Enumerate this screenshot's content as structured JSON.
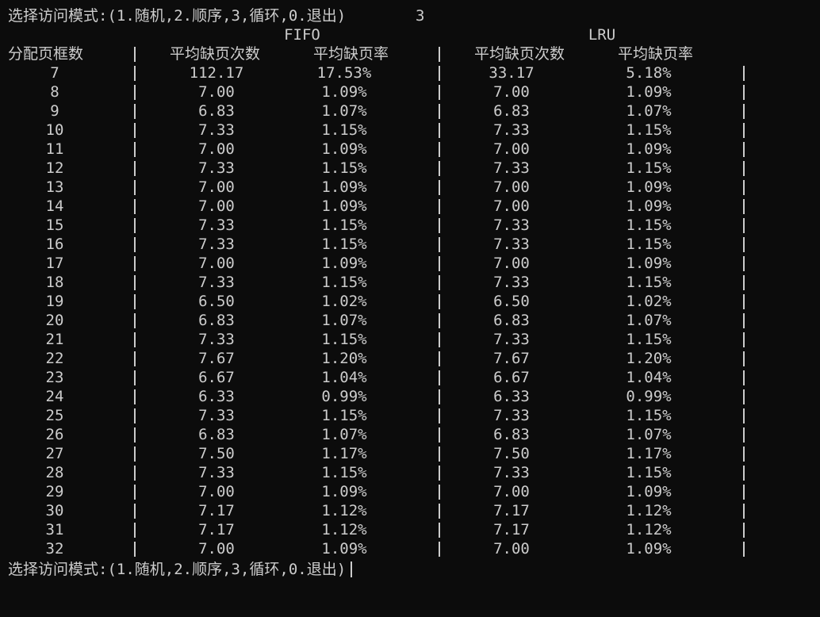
{
  "prompt_text": "选择访问模式:(1.随机,2.顺序,3,循环,0.退出)",
  "first_input": "3",
  "fifo_label": "FIFO",
  "lru_label": "LRU",
  "headers": {
    "frames": "分配页框数",
    "fifo_faults": "平均缺页次数",
    "fifo_rate": "平均缺页率",
    "lru_faults": "平均缺页次数",
    "lru_rate": "平均缺页率"
  },
  "separator_char": "|",
  "rows": [
    {
      "frames": "7",
      "fifo_faults": "112.17",
      "fifo_rate": "17.53%",
      "lru_faults": "33.17",
      "lru_rate": "5.18%"
    },
    {
      "frames": "8",
      "fifo_faults": "7.00",
      "fifo_rate": "1.09%",
      "lru_faults": "7.00",
      "lru_rate": "1.09%"
    },
    {
      "frames": "9",
      "fifo_faults": "6.83",
      "fifo_rate": "1.07%",
      "lru_faults": "6.83",
      "lru_rate": "1.07%"
    },
    {
      "frames": "10",
      "fifo_faults": "7.33",
      "fifo_rate": "1.15%",
      "lru_faults": "7.33",
      "lru_rate": "1.15%"
    },
    {
      "frames": "11",
      "fifo_faults": "7.00",
      "fifo_rate": "1.09%",
      "lru_faults": "7.00",
      "lru_rate": "1.09%"
    },
    {
      "frames": "12",
      "fifo_faults": "7.33",
      "fifo_rate": "1.15%",
      "lru_faults": "7.33",
      "lru_rate": "1.15%"
    },
    {
      "frames": "13",
      "fifo_faults": "7.00",
      "fifo_rate": "1.09%",
      "lru_faults": "7.00",
      "lru_rate": "1.09%"
    },
    {
      "frames": "14",
      "fifo_faults": "7.00",
      "fifo_rate": "1.09%",
      "lru_faults": "7.00",
      "lru_rate": "1.09%"
    },
    {
      "frames": "15",
      "fifo_faults": "7.33",
      "fifo_rate": "1.15%",
      "lru_faults": "7.33",
      "lru_rate": "1.15%"
    },
    {
      "frames": "16",
      "fifo_faults": "7.33",
      "fifo_rate": "1.15%",
      "lru_faults": "7.33",
      "lru_rate": "1.15%"
    },
    {
      "frames": "17",
      "fifo_faults": "7.00",
      "fifo_rate": "1.09%",
      "lru_faults": "7.00",
      "lru_rate": "1.09%"
    },
    {
      "frames": "18",
      "fifo_faults": "7.33",
      "fifo_rate": "1.15%",
      "lru_faults": "7.33",
      "lru_rate": "1.15%"
    },
    {
      "frames": "19",
      "fifo_faults": "6.50",
      "fifo_rate": "1.02%",
      "lru_faults": "6.50",
      "lru_rate": "1.02%"
    },
    {
      "frames": "20",
      "fifo_faults": "6.83",
      "fifo_rate": "1.07%",
      "lru_faults": "6.83",
      "lru_rate": "1.07%"
    },
    {
      "frames": "21",
      "fifo_faults": "7.33",
      "fifo_rate": "1.15%",
      "lru_faults": "7.33",
      "lru_rate": "1.15%"
    },
    {
      "frames": "22",
      "fifo_faults": "7.67",
      "fifo_rate": "1.20%",
      "lru_faults": "7.67",
      "lru_rate": "1.20%"
    },
    {
      "frames": "23",
      "fifo_faults": "6.67",
      "fifo_rate": "1.04%",
      "lru_faults": "6.67",
      "lru_rate": "1.04%"
    },
    {
      "frames": "24",
      "fifo_faults": "6.33",
      "fifo_rate": "0.99%",
      "lru_faults": "6.33",
      "lru_rate": "0.99%"
    },
    {
      "frames": "25",
      "fifo_faults": "7.33",
      "fifo_rate": "1.15%",
      "lru_faults": "7.33",
      "lru_rate": "1.15%"
    },
    {
      "frames": "26",
      "fifo_faults": "6.83",
      "fifo_rate": "1.07%",
      "lru_faults": "6.83",
      "lru_rate": "1.07%"
    },
    {
      "frames": "27",
      "fifo_faults": "7.50",
      "fifo_rate": "1.17%",
      "lru_faults": "7.50",
      "lru_rate": "1.17%"
    },
    {
      "frames": "28",
      "fifo_faults": "7.33",
      "fifo_rate": "1.15%",
      "lru_faults": "7.33",
      "lru_rate": "1.15%"
    },
    {
      "frames": "29",
      "fifo_faults": "7.00",
      "fifo_rate": "1.09%",
      "lru_faults": "7.00",
      "lru_rate": "1.09%"
    },
    {
      "frames": "30",
      "fifo_faults": "7.17",
      "fifo_rate": "1.12%",
      "lru_faults": "7.17",
      "lru_rate": "1.12%"
    },
    {
      "frames": "31",
      "fifo_faults": "7.17",
      "fifo_rate": "1.12%",
      "lru_faults": "7.17",
      "lru_rate": "1.12%"
    },
    {
      "frames": "32",
      "fifo_faults": "7.00",
      "fifo_rate": "1.09%",
      "lru_faults": "7.00",
      "lru_rate": "1.09%"
    }
  ],
  "last_prompt_text": "选择访问模式:(1.随机,2.顺序,3,循环,0.退出)",
  "colors": {
    "background": "#0c0c0c",
    "foreground": "#cccccc"
  }
}
